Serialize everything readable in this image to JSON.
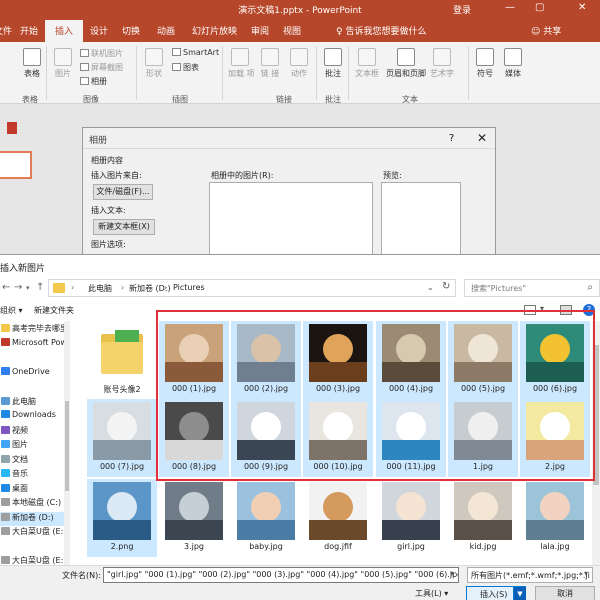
{
  "app": {
    "title": "演示文稿1.pptx  -  PowerPoint",
    "login": "登录",
    "controls": [
      "—",
      "▢",
      "✕"
    ]
  },
  "ribbon": {
    "tabs": [
      "文件",
      "开始",
      "插入",
      "设计",
      "切换",
      "动画",
      "幻灯片放映",
      "审阅",
      "视图"
    ],
    "active_tab": "插入",
    "tell_me": "告诉我您想要做什么",
    "share": "共享",
    "buttons": {
      "table": "表格",
      "picture": "图片",
      "online_picture": "联机图片",
      "screenshot": "屏幕截图",
      "album": "相册",
      "shapes": "形状",
      "smartart": "SmartArt",
      "chart": "图表",
      "addins": "加载\n项",
      "link": "链\n接",
      "action": "动作",
      "comment": "批注",
      "textbox": "文本框",
      "header_footer": "页眉和页脚",
      "wordart": "艺术字",
      "symbol": "符号",
      "media": "媒体"
    },
    "groups": {
      "table": "表格",
      "images": "图像",
      "illustrations": "插图",
      "links": "链接",
      "comments": "批注",
      "text": "文本"
    }
  },
  "album_dialog": {
    "title": "相册",
    "help": "?",
    "close": "✕",
    "section": "相册内容",
    "insert_from": "插入图片来自:",
    "file_disk_btn": "文件/磁盘(F)...",
    "insert_text": "插入文本:",
    "new_textbox_btn": "新建文本框(X)",
    "picture_options": "图片选项:",
    "pictures_in_album": "相册中的图片(R):",
    "preview": "预览:"
  },
  "insert_dialog": {
    "title": "插入新图片",
    "breadcrumbs": [
      "此电脑",
      "新加卷 (D:)",
      "Pictures"
    ],
    "search_placeholder": "搜索\"Pictures\"",
    "organize": "组织 ▾",
    "new_folder": "新建文件夹",
    "nav_items": [
      {
        "label": "高考完毕去哪里",
        "color": "#f2c94c"
      },
      {
        "label": "Microsoft Pow",
        "color": "#c0392b"
      },
      {
        "label": "",
        "color": ""
      },
      {
        "label": "OneDrive",
        "color": "#2f80ed"
      },
      {
        "label": "",
        "color": ""
      },
      {
        "label": "此电脑",
        "color": "#5b9bd5"
      },
      {
        "label": "Downloads",
        "color": "#1e88e5"
      },
      {
        "label": "视频",
        "color": "#7e57c2"
      },
      {
        "label": "图片",
        "color": "#42a5f5"
      },
      {
        "label": "文档",
        "color": "#90a4ae"
      },
      {
        "label": "音乐",
        "color": "#29b6f6"
      },
      {
        "label": "桌面",
        "color": "#1e88e5"
      },
      {
        "label": "本地磁盘 (C:)",
        "color": "#9e9e9e"
      },
      {
        "label": "新加卷 (D:)",
        "color": "#9e9e9e"
      },
      {
        "label": "大白菜U盘 (E:",
        "color": "#9e9e9e"
      },
      {
        "label": "",
        "color": ""
      },
      {
        "label": "大白菜U盘 (E:",
        "color": "#9e9e9e"
      }
    ],
    "nav_selected_index": 13,
    "files": [
      {
        "name": "账号头像2",
        "selected": false,
        "colors": [
          "#f7f7f7",
          "#e8c24a",
          "#4caf50"
        ],
        "kind": "folder"
      },
      {
        "name": "000 (1).jpg",
        "selected": true,
        "colors": [
          "#c9a27a",
          "#e9cfb3",
          "#8a5a3b"
        ]
      },
      {
        "name": "000 (2).jpg",
        "selected": true,
        "colors": [
          "#a7b8c7",
          "#d9c2a8",
          "#6f7f8f"
        ]
      },
      {
        "name": "000 (3).jpg",
        "selected": true,
        "colors": [
          "#1c1410",
          "#e0a35a",
          "#6b3f1e"
        ]
      },
      {
        "name": "000 (4).jpg",
        "selected": true,
        "colors": [
          "#9c8b74",
          "#d7c9b0",
          "#5b4b3a"
        ]
      },
      {
        "name": "000 (5).jpg",
        "selected": true,
        "colors": [
          "#c9b9a3",
          "#efe6d8",
          "#8c7a66"
        ]
      },
      {
        "name": "000 (6).jpg",
        "selected": true,
        "colors": [
          "#2e8b7a",
          "#f2c230",
          "#1c5e52"
        ]
      },
      {
        "name": "000 (7).jpg",
        "selected": true,
        "colors": [
          "#d8dde2",
          "#f4f4f4",
          "#8a99a6"
        ]
      },
      {
        "name": "000 (8).jpg",
        "selected": true,
        "colors": [
          "#4a4a4a",
          "#8d8d8d",
          "#d8d8d8"
        ]
      },
      {
        "name": "000 (9).jpg",
        "selected": true,
        "colors": [
          "#cfd6dd",
          "#ffffff",
          "#3a4653"
        ]
      },
      {
        "name": "000 (10).jpg",
        "selected": true,
        "colors": [
          "#e9e6e0",
          "#ffffff",
          "#7d7368"
        ]
      },
      {
        "name": "000 (11).jpg",
        "selected": true,
        "colors": [
          "#dde6ee",
          "#ffffff",
          "#2e86c1"
        ]
      },
      {
        "name": "1.jpg",
        "selected": true,
        "colors": [
          "#c7ccd1",
          "#efefef",
          "#7f8a94"
        ]
      },
      {
        "name": "2.jpg",
        "selected": true,
        "colors": [
          "#f3e9a0",
          "#ffffff",
          "#d9a37c"
        ]
      },
      {
        "name": "2.png",
        "selected": true,
        "colors": [
          "#5c95c8",
          "#dbe9f5",
          "#2a5a86"
        ]
      },
      {
        "name": "3.jpg",
        "selected": false,
        "colors": [
          "#707c88",
          "#c6ced6",
          "#3c4650"
        ]
      },
      {
        "name": "baby.jpg",
        "selected": false,
        "colors": [
          "#9bc1df",
          "#f0cfb4",
          "#4a7ca6"
        ]
      },
      {
        "name": "dog.jfif",
        "selected": false,
        "colors": [
          "#f2f2f2",
          "#d49a5e",
          "#6b4a2c"
        ]
      },
      {
        "name": "girl.jpg",
        "selected": false,
        "colors": [
          "#d1d6dc",
          "#f5e3d3",
          "#36414d"
        ]
      },
      {
        "name": "kid.jpg",
        "selected": false,
        "colors": [
          "#cfc8bf",
          "#f3e6d4",
          "#5a5047"
        ]
      },
      {
        "name": "lala.jpg",
        "selected": false,
        "colors": [
          "#9cc3d8",
          "#f2d2c0",
          "#5e7f92"
        ]
      }
    ],
    "filename_label": "文件名(N):",
    "filename_value": "\"girl.jpg\" \"000 (1).jpg\" \"000 (2).jpg\" \"000 (3).jpg\" \"000 (4).jpg\" \"000 (5).jpg\" \"000 (6).jpg\" \"jp",
    "filetype_value": "所有图片(*.emf;*.wmf;*.jpg;*.ji",
    "tools": "工具(L) ▾",
    "insert": "插入(S)",
    "cancel": "取消"
  },
  "colors": {
    "accent": "#b7472a",
    "selection": "#cce8ff",
    "highlight_box": "#e0303a"
  }
}
